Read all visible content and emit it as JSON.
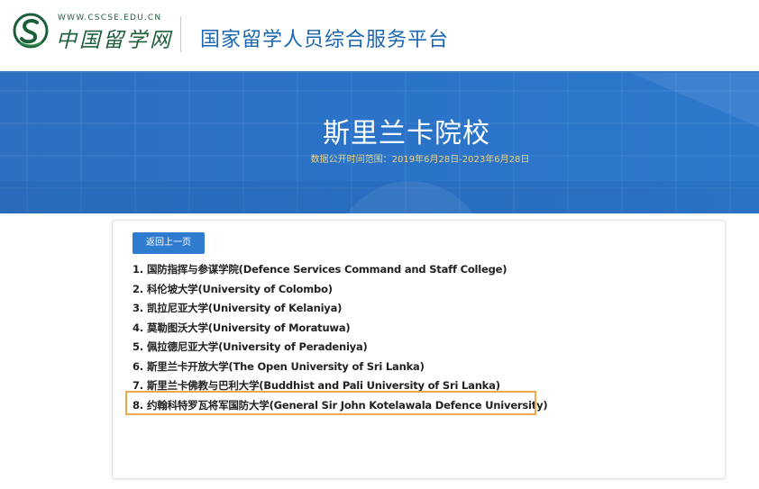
{
  "header": {
    "logo_url": "WWW.CSCSE.EDU.CN",
    "logo_cn": "中国留学网",
    "platform_title": "国家留学人员综合服务平台"
  },
  "banner": {
    "title": "斯里兰卡院校",
    "subtitle": "数据公开时间范围：2019年6月28日-2023年6月28日"
  },
  "card": {
    "back_label": "返回上一页",
    "schools": [
      {
        "num": "1.",
        "name": "国防指挥与参谋学院(Defence Services Command and Staff College)"
      },
      {
        "num": "2.",
        "name": "科伦坡大学(University of Colombo)"
      },
      {
        "num": "3.",
        "name": "凯拉尼亚大学(University of Kelaniya)"
      },
      {
        "num": "4.",
        "name": "莫勒图沃大学(University of Moratuwa)"
      },
      {
        "num": "5.",
        "name": "佩拉德尼亚大学(University of Peradeniya)"
      },
      {
        "num": "6.",
        "name": "斯里兰卡开放大学(The Open University of Sri Lanka)"
      },
      {
        "num": "7.",
        "name": "斯里兰卡佛教与巴利大学(Buddhist and Pali University of Sri Lanka)"
      },
      {
        "num": "8.",
        "name": "约翰科特罗瓦将军国防大学(General Sir John Kotelawala Defence University)"
      }
    ]
  },
  "colors": {
    "brand_green": "#1d5f3a",
    "brand_blue": "#1a66b0",
    "banner_blue": "#2a73c8",
    "subtitle_gold": "#f2d27a",
    "button_blue": "#2f7bd0",
    "highlight_orange": "#f0a84a"
  }
}
